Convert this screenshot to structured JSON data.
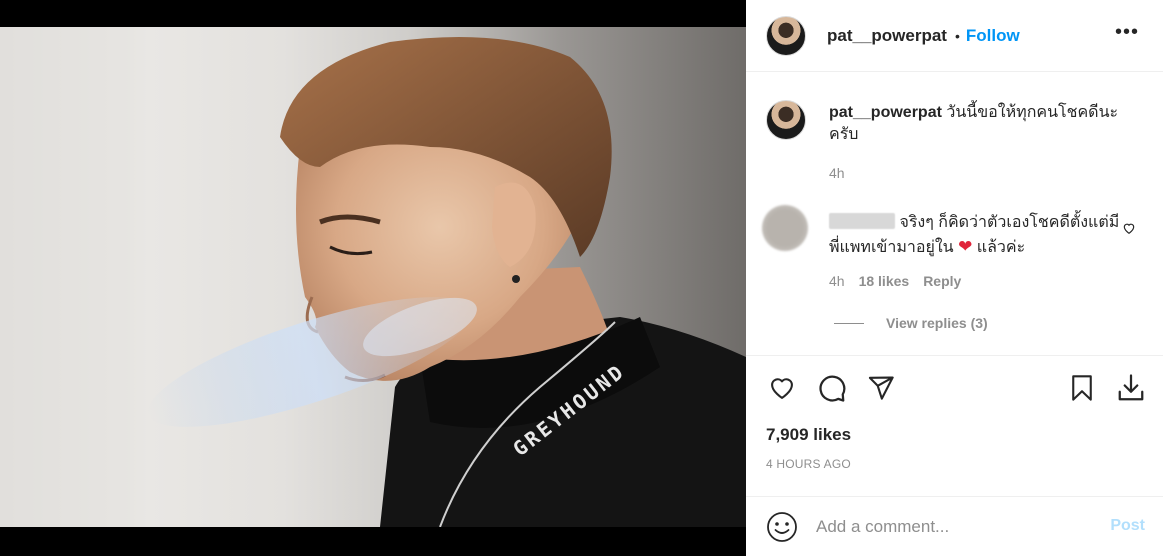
{
  "header": {
    "username": "pat__powerpat",
    "separator": "•",
    "follow_label": "Follow",
    "more_label": "•••"
  },
  "caption": {
    "username": "pat__powerpat",
    "text": "วันนี้ขอให้ทุกคนโชคดีนะครับ",
    "time": "4h"
  },
  "comment": {
    "text_before": "จริงๆ ก็คิดว่าตัวเองโชคดีตั้งแต่มีพี่แพทเข้ามาอยู่ใน",
    "emoji": "❤",
    "text_after": "แล้วค่ะ",
    "time": "4h",
    "likes": "18 likes",
    "reply_label": "Reply",
    "view_replies": "View replies (3)"
  },
  "post": {
    "likes": "7,909 likes",
    "time_ago": "4 HOURS AGO",
    "shirt_text": "GREYHOUND"
  },
  "add_comment": {
    "placeholder": "Add a comment...",
    "post_label": "Post"
  },
  "icons": [
    "heart-icon",
    "comment-icon",
    "share-icon",
    "bookmark-icon",
    "download-icon",
    "emoji-icon",
    "more-options-icon"
  ]
}
